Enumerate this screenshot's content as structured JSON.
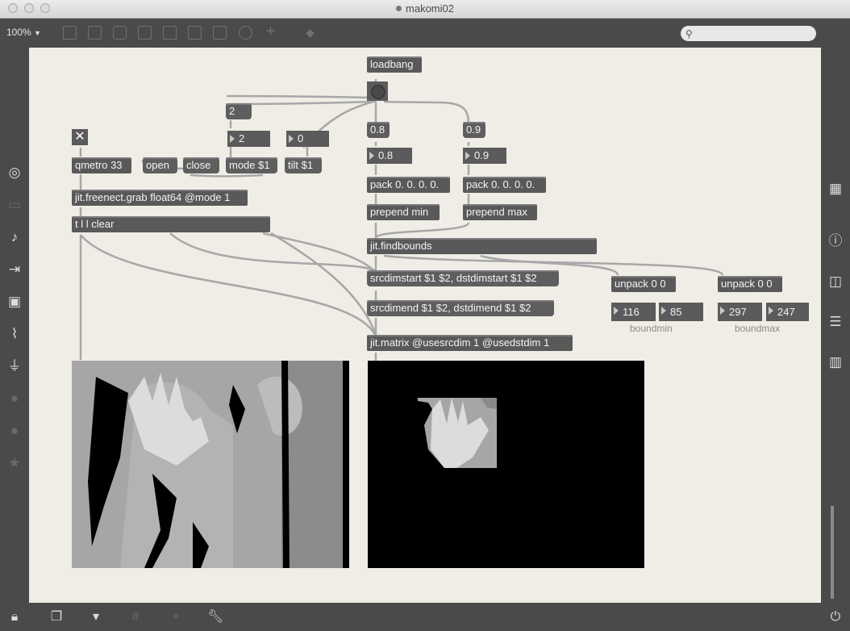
{
  "window": {
    "title": "makomi02"
  },
  "toolbar": {
    "zoom": "100%",
    "zoom_arrow": "▼",
    "search_icon": "search-icon"
  },
  "patcher": {
    "loadbang": "loadbang",
    "float_a": "0.8",
    "float_b": "0.9",
    "num_a": "0.8",
    "num_b": "0.9",
    "pack_a": "pack 0. 0. 0. 0.",
    "pack_b": "pack 0. 0. 0. 0.",
    "prepend_min": "prepend min",
    "prepend_max": "prepend max",
    "findbounds": "jit.findbounds",
    "srcdimstart": "srcdimstart $1 $2, dstdimstart $1 $2",
    "srcdimend": "srcdimend $1 $2, dstdimend $1 $2",
    "matrix": "jit.matrix @usesrcdim 1 @usedstdim 1",
    "unpack_a": "unpack 0 0",
    "unpack_b": "unpack 0 0",
    "boundmin_x": "116",
    "boundmin_y": "85",
    "boundmax_x": "297",
    "boundmax_y": "247",
    "boundmin_label": "boundmin",
    "boundmax_label": "boundmax",
    "toggle_glyph": "✕",
    "qmetro": "qmetro 33",
    "open": "open",
    "close": "close",
    "mode_msg": "mode $1",
    "tilt_msg": "tilt $1",
    "mode_int_msg": "2",
    "mode_num": "2",
    "tilt_num": "0",
    "freenect": "jit.freenect.grab float64 @mode 1",
    "trigger": "t l l clear"
  },
  "icon_names": [
    "patcher-icon",
    "object-icon",
    "message-icon",
    "toggle-icon",
    "bang-icon",
    "playback-icon",
    "slider-icon",
    "dial-icon",
    "add-icon",
    "paint-icon"
  ],
  "colors": {
    "canvas": "#f0ede6",
    "object": "#595959",
    "cord": "#a0a0a0",
    "chrome": "#4a4a4a"
  }
}
